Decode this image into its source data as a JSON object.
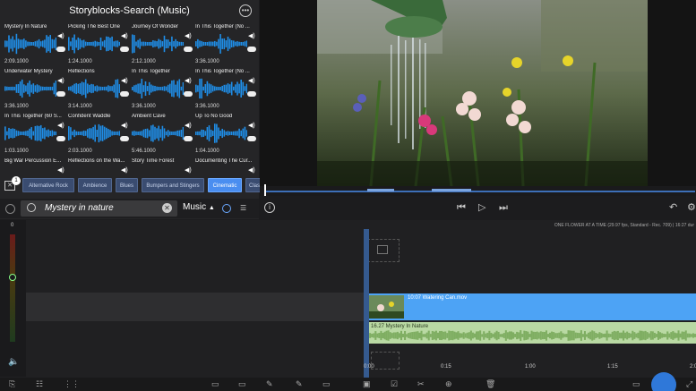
{
  "library": {
    "title": "Storyblocks-Search (Music)",
    "more_icon": "ellipsis-circle-icon",
    "tracks": [
      {
        "name": "Mystery In Nature",
        "duration": "2:09.1000"
      },
      {
        "name": "Picking The Best One",
        "duration": "1:24.1000"
      },
      {
        "name": "Journey Of Wonder",
        "duration": "2:12.1000"
      },
      {
        "name": "In This Together (No ...",
        "duration": "3:36.1000"
      },
      {
        "name": "Underwater Mystery",
        "duration": "3:36.1000"
      },
      {
        "name": "Reflections",
        "duration": "3:14.1000"
      },
      {
        "name": "In This Together",
        "duration": "3:36.1000"
      },
      {
        "name": "In This Together (No ...",
        "duration": "3:36.1000"
      },
      {
        "name": "In This Together (60 S...",
        "duration": "1:03.1000"
      },
      {
        "name": "Confident Waddle",
        "duration": "2:03.1000"
      },
      {
        "name": "Ambient Cave",
        "duration": "5:46.1000"
      },
      {
        "name": "Up To No Good",
        "duration": "1:04.1000"
      },
      {
        "name": "Big War Percussion E...",
        "duration": ""
      },
      {
        "name": "Reflections on the Wa...",
        "duration": ""
      },
      {
        "name": "Story Time Forest",
        "duration": ""
      },
      {
        "name": "Documenting The Cur...",
        "duration": ""
      }
    ],
    "chips": [
      "Alternative Rock",
      "Ambience",
      "Blues",
      "Bumpers and Stingers",
      "Cinematic",
      "Clas"
    ],
    "active_chip": "Cinematic",
    "badge_count": "1"
  },
  "search": {
    "value": "Mystery in nature",
    "category": "Music",
    "category_arrow": "▲"
  },
  "preview": {
    "info_icon": "info-icon"
  },
  "timeline": {
    "meter_top": "0",
    "info": "ONE FLOWER AT A TIME (29.97 fps, Standard - Rec. 709) | 16:27 dur",
    "video_clip_label": "10:07 Watering Can.mov",
    "audio_clip_label": "16.27 Mystery In Nature",
    "ruler": [
      "0:00",
      "0:15",
      "1:00",
      "1:15",
      "2:00"
    ]
  },
  "colors": {
    "accent": "#4da3f5",
    "audio": "#b9d9a3",
    "waveform": "#1f8ee8"
  }
}
